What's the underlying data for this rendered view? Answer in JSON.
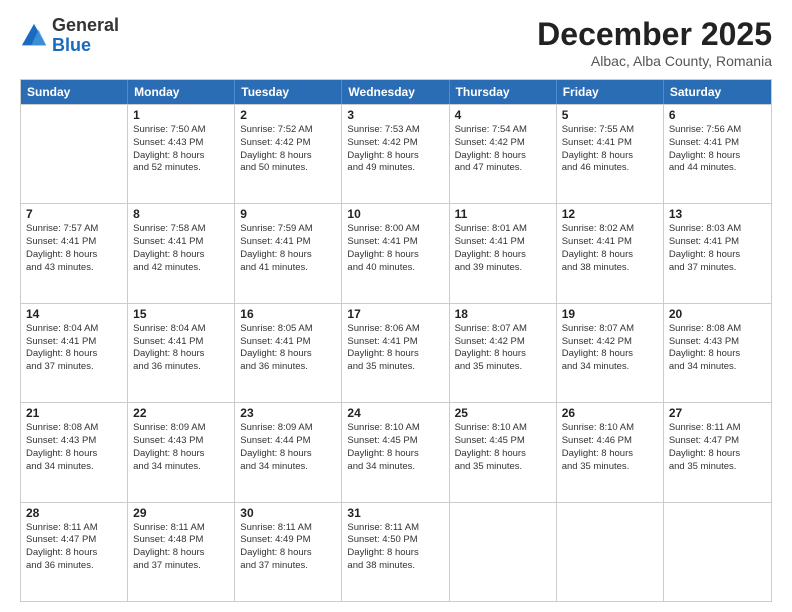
{
  "logo": {
    "general": "General",
    "blue": "Blue"
  },
  "title": "December 2025",
  "subtitle": "Albac, Alba County, Romania",
  "days": [
    "Sunday",
    "Monday",
    "Tuesday",
    "Wednesday",
    "Thursday",
    "Friday",
    "Saturday"
  ],
  "rows": [
    [
      {
        "day": "",
        "lines": []
      },
      {
        "day": "1",
        "lines": [
          "Sunrise: 7:50 AM",
          "Sunset: 4:43 PM",
          "Daylight: 8 hours",
          "and 52 minutes."
        ]
      },
      {
        "day": "2",
        "lines": [
          "Sunrise: 7:52 AM",
          "Sunset: 4:42 PM",
          "Daylight: 8 hours",
          "and 50 minutes."
        ]
      },
      {
        "day": "3",
        "lines": [
          "Sunrise: 7:53 AM",
          "Sunset: 4:42 PM",
          "Daylight: 8 hours",
          "and 49 minutes."
        ]
      },
      {
        "day": "4",
        "lines": [
          "Sunrise: 7:54 AM",
          "Sunset: 4:42 PM",
          "Daylight: 8 hours",
          "and 47 minutes."
        ]
      },
      {
        "day": "5",
        "lines": [
          "Sunrise: 7:55 AM",
          "Sunset: 4:41 PM",
          "Daylight: 8 hours",
          "and 46 minutes."
        ]
      },
      {
        "day": "6",
        "lines": [
          "Sunrise: 7:56 AM",
          "Sunset: 4:41 PM",
          "Daylight: 8 hours",
          "and 44 minutes."
        ]
      }
    ],
    [
      {
        "day": "7",
        "lines": [
          "Sunrise: 7:57 AM",
          "Sunset: 4:41 PM",
          "Daylight: 8 hours",
          "and 43 minutes."
        ]
      },
      {
        "day": "8",
        "lines": [
          "Sunrise: 7:58 AM",
          "Sunset: 4:41 PM",
          "Daylight: 8 hours",
          "and 42 minutes."
        ]
      },
      {
        "day": "9",
        "lines": [
          "Sunrise: 7:59 AM",
          "Sunset: 4:41 PM",
          "Daylight: 8 hours",
          "and 41 minutes."
        ]
      },
      {
        "day": "10",
        "lines": [
          "Sunrise: 8:00 AM",
          "Sunset: 4:41 PM",
          "Daylight: 8 hours",
          "and 40 minutes."
        ]
      },
      {
        "day": "11",
        "lines": [
          "Sunrise: 8:01 AM",
          "Sunset: 4:41 PM",
          "Daylight: 8 hours",
          "and 39 minutes."
        ]
      },
      {
        "day": "12",
        "lines": [
          "Sunrise: 8:02 AM",
          "Sunset: 4:41 PM",
          "Daylight: 8 hours",
          "and 38 minutes."
        ]
      },
      {
        "day": "13",
        "lines": [
          "Sunrise: 8:03 AM",
          "Sunset: 4:41 PM",
          "Daylight: 8 hours",
          "and 37 minutes."
        ]
      }
    ],
    [
      {
        "day": "14",
        "lines": [
          "Sunrise: 8:04 AM",
          "Sunset: 4:41 PM",
          "Daylight: 8 hours",
          "and 37 minutes."
        ]
      },
      {
        "day": "15",
        "lines": [
          "Sunrise: 8:04 AM",
          "Sunset: 4:41 PM",
          "Daylight: 8 hours",
          "and 36 minutes."
        ]
      },
      {
        "day": "16",
        "lines": [
          "Sunrise: 8:05 AM",
          "Sunset: 4:41 PM",
          "Daylight: 8 hours",
          "and 36 minutes."
        ]
      },
      {
        "day": "17",
        "lines": [
          "Sunrise: 8:06 AM",
          "Sunset: 4:41 PM",
          "Daylight: 8 hours",
          "and 35 minutes."
        ]
      },
      {
        "day": "18",
        "lines": [
          "Sunrise: 8:07 AM",
          "Sunset: 4:42 PM",
          "Daylight: 8 hours",
          "and 35 minutes."
        ]
      },
      {
        "day": "19",
        "lines": [
          "Sunrise: 8:07 AM",
          "Sunset: 4:42 PM",
          "Daylight: 8 hours",
          "and 34 minutes."
        ]
      },
      {
        "day": "20",
        "lines": [
          "Sunrise: 8:08 AM",
          "Sunset: 4:43 PM",
          "Daylight: 8 hours",
          "and 34 minutes."
        ]
      }
    ],
    [
      {
        "day": "21",
        "lines": [
          "Sunrise: 8:08 AM",
          "Sunset: 4:43 PM",
          "Daylight: 8 hours",
          "and 34 minutes."
        ]
      },
      {
        "day": "22",
        "lines": [
          "Sunrise: 8:09 AM",
          "Sunset: 4:43 PM",
          "Daylight: 8 hours",
          "and 34 minutes."
        ]
      },
      {
        "day": "23",
        "lines": [
          "Sunrise: 8:09 AM",
          "Sunset: 4:44 PM",
          "Daylight: 8 hours",
          "and 34 minutes."
        ]
      },
      {
        "day": "24",
        "lines": [
          "Sunrise: 8:10 AM",
          "Sunset: 4:45 PM",
          "Daylight: 8 hours",
          "and 34 minutes."
        ]
      },
      {
        "day": "25",
        "lines": [
          "Sunrise: 8:10 AM",
          "Sunset: 4:45 PM",
          "Daylight: 8 hours",
          "and 35 minutes."
        ]
      },
      {
        "day": "26",
        "lines": [
          "Sunrise: 8:10 AM",
          "Sunset: 4:46 PM",
          "Daylight: 8 hours",
          "and 35 minutes."
        ]
      },
      {
        "day": "27",
        "lines": [
          "Sunrise: 8:11 AM",
          "Sunset: 4:47 PM",
          "Daylight: 8 hours",
          "and 35 minutes."
        ]
      }
    ],
    [
      {
        "day": "28",
        "lines": [
          "Sunrise: 8:11 AM",
          "Sunset: 4:47 PM",
          "Daylight: 8 hours",
          "and 36 minutes."
        ]
      },
      {
        "day": "29",
        "lines": [
          "Sunrise: 8:11 AM",
          "Sunset: 4:48 PM",
          "Daylight: 8 hours",
          "and 37 minutes."
        ]
      },
      {
        "day": "30",
        "lines": [
          "Sunrise: 8:11 AM",
          "Sunset: 4:49 PM",
          "Daylight: 8 hours",
          "and 37 minutes."
        ]
      },
      {
        "day": "31",
        "lines": [
          "Sunrise: 8:11 AM",
          "Sunset: 4:50 PM",
          "Daylight: 8 hours",
          "and 38 minutes."
        ]
      },
      {
        "day": "",
        "lines": []
      },
      {
        "day": "",
        "lines": []
      },
      {
        "day": "",
        "lines": []
      }
    ]
  ]
}
